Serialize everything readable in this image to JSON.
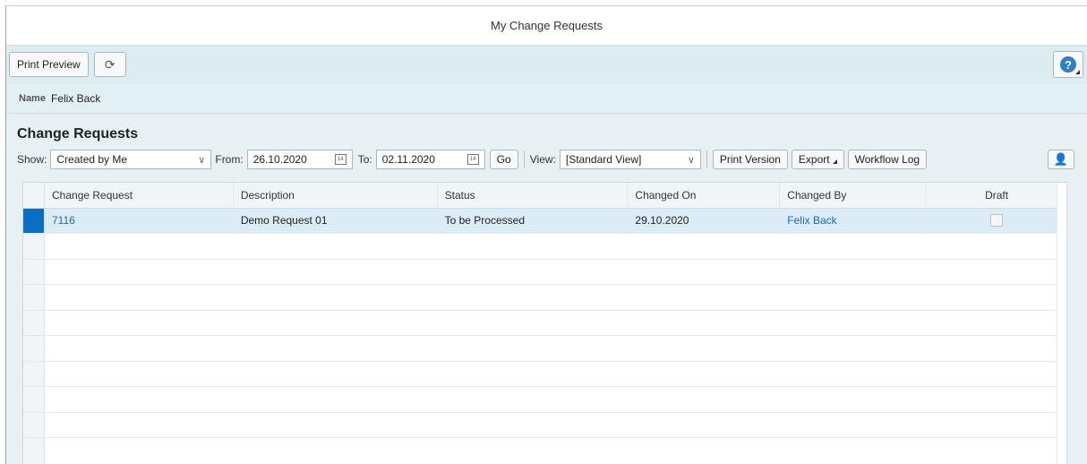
{
  "window": {
    "title": "My Change Requests"
  },
  "app_toolbar": {
    "print_preview_label": "Print Preview",
    "refresh_icon": "refresh-icon",
    "help_icon": "help-icon",
    "help_glyph": "?"
  },
  "header": {
    "name_label": "Name",
    "name_value": "Felix Back"
  },
  "section": {
    "title": "Change Requests"
  },
  "table_toolbar": {
    "show_label": "Show:",
    "show_value": "Created by Me",
    "from_label": "From:",
    "from_value": "26.10.2020",
    "to_label": "To:",
    "to_value": "02.11.2020",
    "go_label": "Go",
    "view_label": "View:",
    "view_value": "[Standard View]",
    "print_version_label": "Print Version",
    "export_label": "Export",
    "workflow_log_label": "Workflow Log",
    "calendar_day": "14"
  },
  "table": {
    "columns": [
      "Change Request",
      "Description",
      "Status",
      "Changed On",
      "Changed By",
      "Draft"
    ],
    "rows": [
      {
        "change_request": "7116",
        "description": "Demo Request 01",
        "status": "To be Processed",
        "changed_on": "29.10.2020",
        "changed_by": "Felix Back",
        "draft": false
      }
    ]
  },
  "colors": {
    "accent": "#0a6ec4",
    "link": "#1a6bb0",
    "toolbar_bg": "#dcecf1",
    "selected_row": "#dcecf6"
  }
}
